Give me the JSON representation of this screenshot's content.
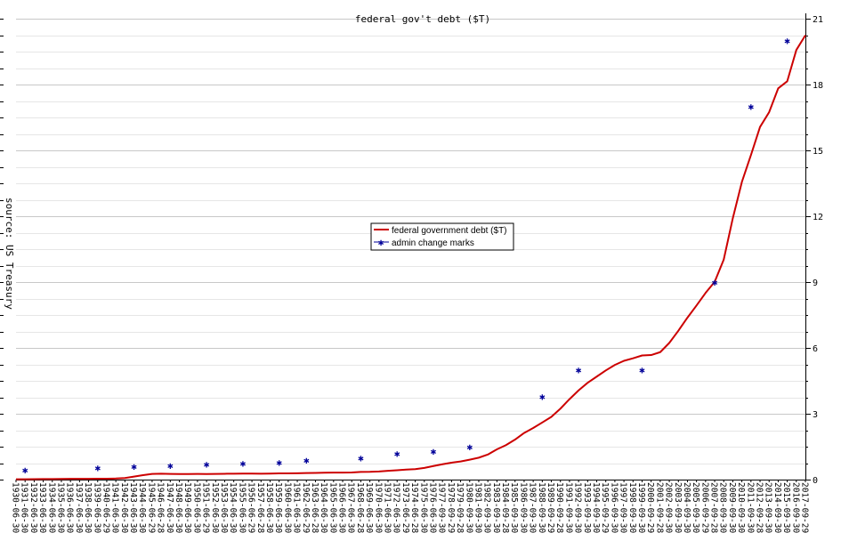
{
  "chart_data": {
    "type": "line",
    "title": "federal gov't debt ($T)",
    "ylabel": "source: US Treasury",
    "ylim": [
      0,
      21
    ],
    "yticks": [
      0,
      3,
      6,
      9,
      12,
      15,
      18,
      21
    ],
    "grid": true,
    "legend_position": "center",
    "categories": [
      "1930-06-30",
      "1931-06-30",
      "1932-06-30",
      "1933-06-30",
      "1934-06-30",
      "1935-06-30",
      "1936-06-30",
      "1937-06-30",
      "1938-06-30",
      "1939-06-30",
      "1940-06-29",
      "1941-06-30",
      "1942-06-30",
      "1943-06-30",
      "1944-06-30",
      "1945-06-29",
      "1946-06-28",
      "1947-06-30",
      "1948-06-30",
      "1949-06-30",
      "1950-06-30",
      "1951-06-29",
      "1952-06-30",
      "1953-06-30",
      "1954-06-30",
      "1955-06-30",
      "1956-06-29",
      "1957-06-28",
      "1958-06-30",
      "1959-06-30",
      "1960-06-30",
      "1961-06-30",
      "1962-06-29",
      "1963-06-28",
      "1964-06-30",
      "1965-06-30",
      "1966-06-30",
      "1967-06-30",
      "1968-06-28",
      "1969-06-30",
      "1970-06-30",
      "1971-06-30",
      "1972-06-30",
      "1973-06-29",
      "1974-06-28",
      "1975-06-30",
      "1976-06-30",
      "1977-09-30",
      "1978-09-29",
      "1979-09-28",
      "1980-09-30",
      "1981-09-30",
      "1982-09-30",
      "1983-09-30",
      "1984-09-28",
      "1985-09-30",
      "1986-09-30",
      "1987-09-30",
      "1988-09-30",
      "1989-09-29",
      "1990-09-28",
      "1991-09-30",
      "1992-09-30",
      "1993-09-30",
      "1994-09-30",
      "1995-09-29",
      "1996-09-30",
      "1997-09-30",
      "1998-09-30",
      "1999-09-30",
      "2000-09-29",
      "2001-09-28",
      "2002-09-30",
      "2003-09-30",
      "2004-09-30",
      "2005-09-30",
      "2006-09-29",
      "2007-09-28",
      "2008-09-30",
      "2009-09-30",
      "2010-09-30",
      "2011-09-30",
      "2012-09-28",
      "2013-09-30",
      "2014-09-30",
      "2015-09-30",
      "2016-09-30",
      "2017-09-29"
    ],
    "series": [
      {
        "name": "federal government debt ($T)",
        "color": "#cc0000",
        "marker": "none",
        "values": [
          0.016,
          0.017,
          0.019,
          0.023,
          0.027,
          0.029,
          0.034,
          0.036,
          0.037,
          0.04,
          0.043,
          0.049,
          0.072,
          0.137,
          0.201,
          0.259,
          0.269,
          0.258,
          0.252,
          0.253,
          0.257,
          0.255,
          0.259,
          0.266,
          0.271,
          0.274,
          0.273,
          0.271,
          0.276,
          0.285,
          0.286,
          0.289,
          0.298,
          0.306,
          0.312,
          0.317,
          0.32,
          0.326,
          0.348,
          0.354,
          0.371,
          0.398,
          0.427,
          0.458,
          0.475,
          0.533,
          0.62,
          0.699,
          0.772,
          0.827,
          0.908,
          0.998,
          1.142,
          1.377,
          1.572,
          1.823,
          2.125,
          2.35,
          2.602,
          2.857,
          3.233,
          3.665,
          4.065,
          4.411,
          4.693,
          4.974,
          5.225,
          5.413,
          5.526,
          5.656,
          5.674,
          5.807,
          6.228,
          6.783,
          7.379,
          7.933,
          8.507,
          9.008,
          10.025,
          11.91,
          13.562,
          14.79,
          16.066,
          16.738,
          17.824,
          18.151,
          19.573,
          20.245
        ]
      },
      {
        "name": "admin change marks",
        "color": "#000099",
        "marker": "star",
        "points": [
          {
            "x": "1931-06-30",
            "y": 0.45
          },
          {
            "x": "1939-06-30",
            "y": 0.55
          },
          {
            "x": "1943-06-30",
            "y": 0.6
          },
          {
            "x": "1947-06-30",
            "y": 0.65
          },
          {
            "x": "1951-06-29",
            "y": 0.7
          },
          {
            "x": "1955-06-30",
            "y": 0.75
          },
          {
            "x": "1959-06-30",
            "y": 0.8
          },
          {
            "x": "1962-06-29",
            "y": 0.9
          },
          {
            "x": "1968-06-28",
            "y": 1.0
          },
          {
            "x": "1972-06-30",
            "y": 1.2
          },
          {
            "x": "1976-06-30",
            "y": 1.3
          },
          {
            "x": "1980-09-30",
            "y": 1.5
          },
          {
            "x": "1988-09-30",
            "y": 3.8
          },
          {
            "x": "1992-09-30",
            "y": 5.0
          },
          {
            "x": "1999-09-30",
            "y": 5.0
          },
          {
            "x": "2007-09-28",
            "y": 9.0
          },
          {
            "x": "2011-09-30",
            "y": 17.0
          },
          {
            "x": "2015-09-30",
            "y": 20.0
          }
        ]
      }
    ]
  }
}
